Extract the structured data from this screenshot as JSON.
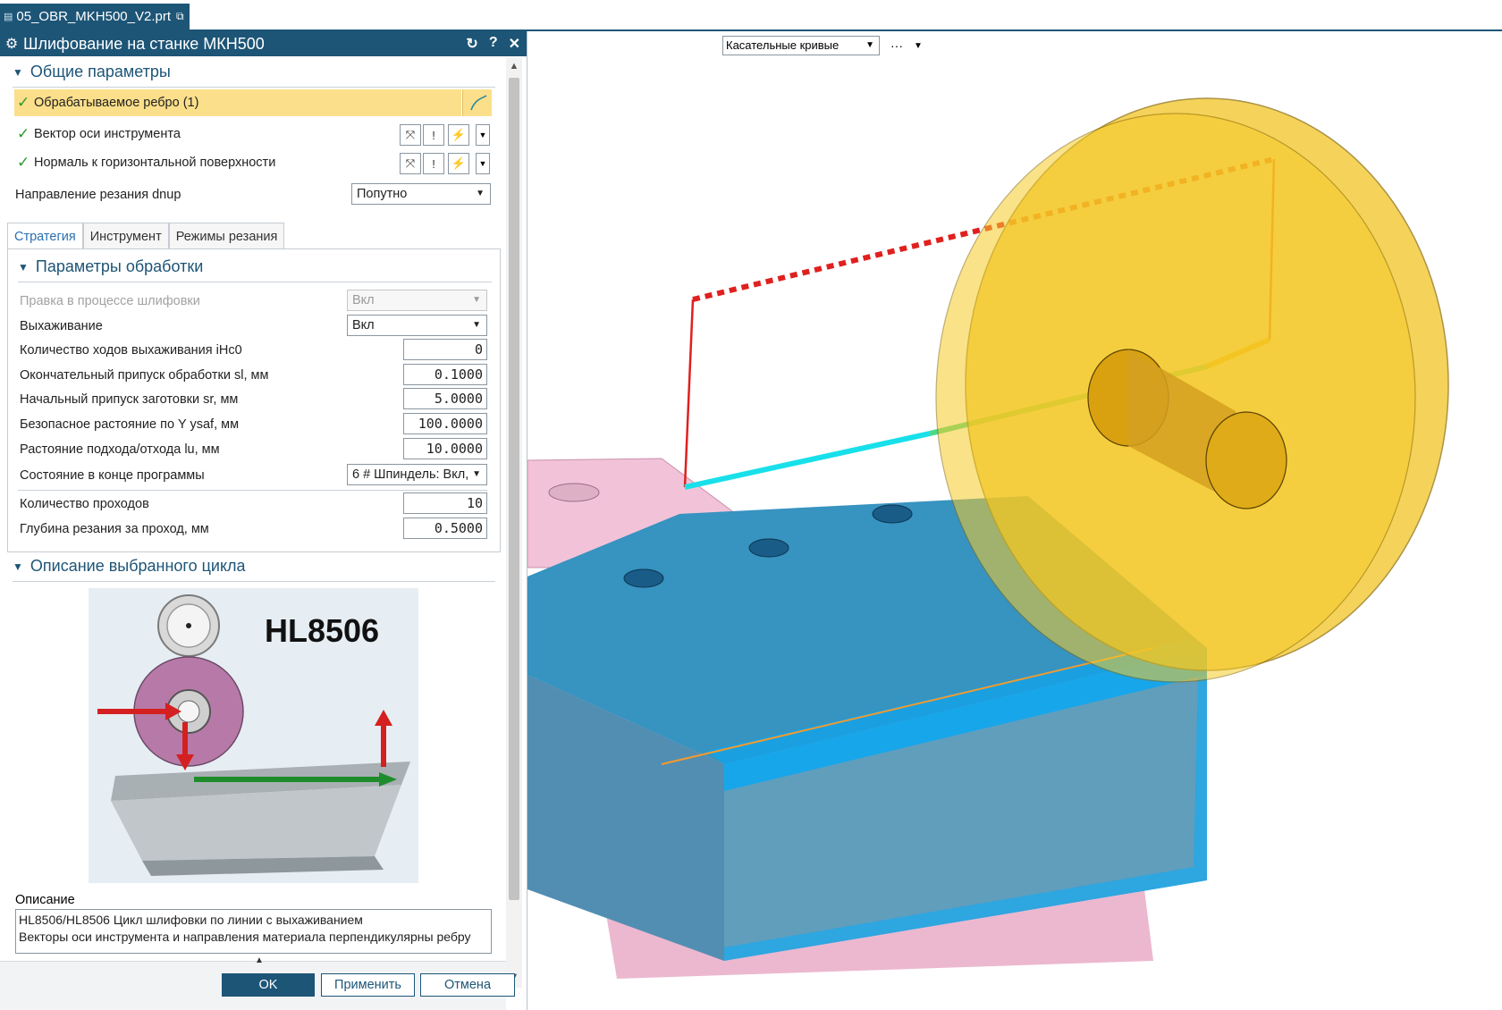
{
  "doc_tab": {
    "title": "05_OBR_MKH500_V2.prt"
  },
  "dialog": {
    "title": "Шлифование на станке МКН500",
    "general": {
      "title": "Общие параметры",
      "edge": "Обрабатываемое ребро (1)",
      "tool_axis": "Вектор оси инструмента",
      "normal": "Нормаль к горизонтальной поверхности",
      "direction_label": "Направление резания  dnup",
      "direction_value": "Попутно"
    },
    "tabs": [
      "Стратегия",
      "Инструмент",
      "Режимы резания"
    ],
    "processing": {
      "title": "Параметры обработки",
      "dress_label": "Правка в процессе шлифовки",
      "dress_value": "Вкл",
      "sparkout_label": "Выхаживание",
      "sparkout_value": "Вкл",
      "sparkout_count_label": "Количество ходов выхаживания iHc0",
      "sparkout_count_value": "0",
      "final_stock_label": "Окончательный припуск обработки sl, мм",
      "final_stock_value": "0.1000",
      "initial_stock_label": "Начальный припуск заготовки sr, мм",
      "initial_stock_value": "5.0000",
      "safe_dist_label": "Безопасное растояние по Y ysaf, мм",
      "safe_dist_value": "100.0000",
      "approach_label": "Растояние подхода/отхода lu, мм",
      "approach_value": "10.0000",
      "end_state_label": "Состояние в конце программы",
      "end_state_value": "6 # Шпиндель: Вкл,",
      "passes_label": "Количество проходов",
      "passes_value": "10",
      "depth_label": "Глубина резания за проход, мм",
      "depth_value": "0.5000"
    },
    "cycle": {
      "title": "Описание выбранного цикла",
      "image_code": "HL8506",
      "desc_label": "Описание",
      "desc_line1": "HL8506/HL8506 Цикл шлифовки по линии с выхаживанием",
      "desc_line2": "Векторы оси инструмента и направления материала перпендикулярны ребру"
    },
    "buttons": {
      "ok": "OK",
      "apply": "Применить",
      "cancel": "Отмена"
    }
  },
  "viewport": {
    "filter_value": "Касательные кривые"
  },
  "colors": {
    "accent": "#1d5577",
    "highlight": "#fbdf8a",
    "check": "#2e9a2e",
    "part_blue": "#1aa0e0",
    "wheel_yellow": "#f2c21a"
  }
}
